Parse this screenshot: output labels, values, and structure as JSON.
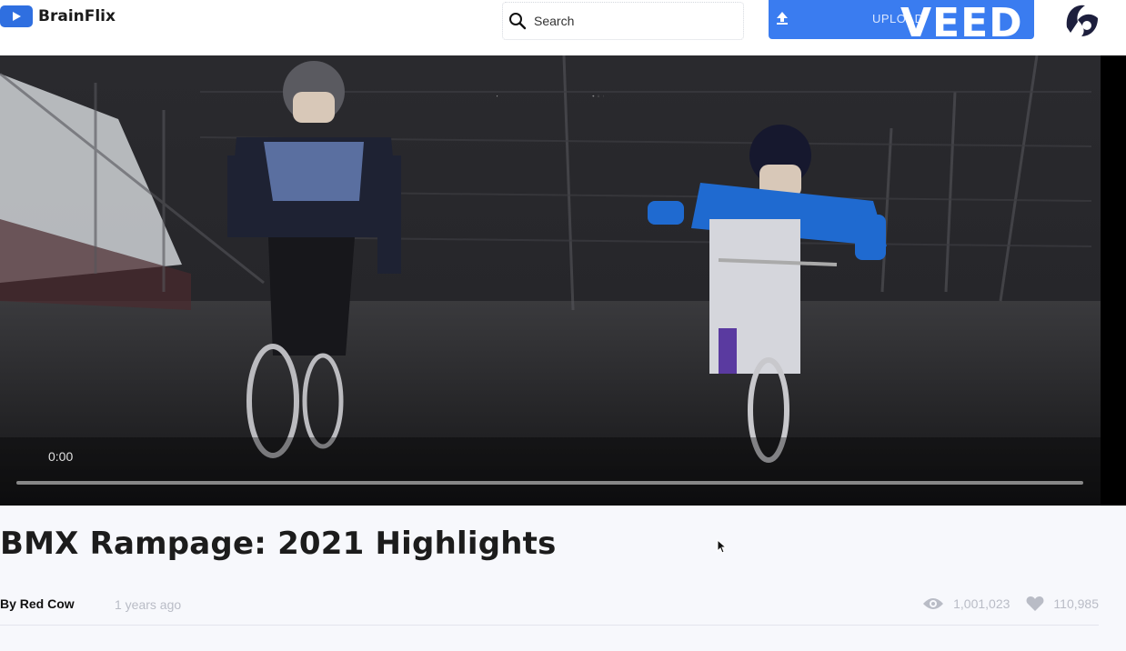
{
  "header": {
    "logo_text": "BrainFlix",
    "search_placeholder": "Search",
    "upload_label": "UPLOAD",
    "watermark": "VEED"
  },
  "player": {
    "time": "0:00",
    "progress": 0
  },
  "video": {
    "title": "BMX Rampage: 2021 Highlights",
    "author": "By Red Cow",
    "posted": "1 years ago",
    "views": "1,001,023",
    "likes": "110,985"
  },
  "icons": [
    "play-logo-icon",
    "search-icon",
    "upload-icon",
    "play-icon",
    "volume-icon",
    "fullscreen-icon",
    "more-icon",
    "eye-icon",
    "heart-icon"
  ],
  "colors": {
    "accent": "#3a7cf0",
    "muted": "#b9bcc6"
  }
}
